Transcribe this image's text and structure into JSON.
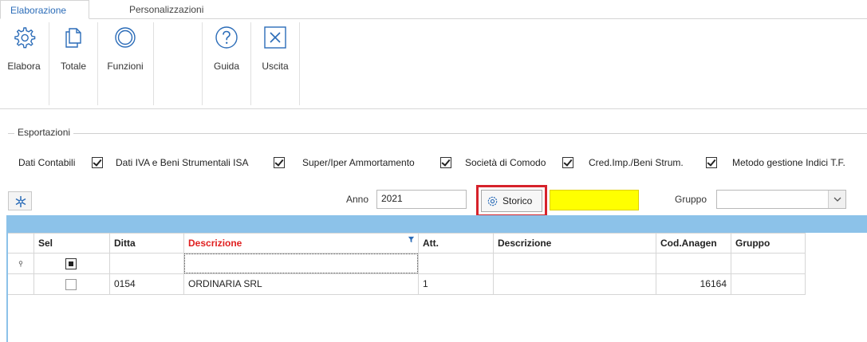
{
  "tabs": [
    {
      "label": "Elaborazione"
    },
    {
      "label": "Personalizzazioni"
    }
  ],
  "ribbon": {
    "buttons": [
      {
        "label": "Elabora",
        "icon": "gear-icon"
      },
      {
        "label": "Totale",
        "icon": "documents-icon"
      },
      {
        "label": "Funzioni",
        "icon": "ring-icon"
      },
      {
        "label": "Guida",
        "icon": "help-icon"
      },
      {
        "label": "Uscita",
        "icon": "close-box-icon"
      }
    ]
  },
  "esportazioni": {
    "title": "Esportazioni",
    "items": [
      {
        "label": "Dati Contabili",
        "checked": true
      },
      {
        "label": "Dati IVA e Beni Strumentali ISA",
        "checked": true
      },
      {
        "label": "Super/Iper Ammortamento",
        "checked": true
      },
      {
        "label": "Società di Comodo",
        "checked": true
      },
      {
        "label": "Cred.Imp./Beni Strum.",
        "checked": true
      },
      {
        "label": "Metodo gestione Indici T.F.",
        "checked": false
      }
    ]
  },
  "filters": {
    "anno_label": "Anno",
    "anno_value": "2021",
    "storico_label": "Storico",
    "gruppo_label": "Gruppo",
    "gruppo_value": ""
  },
  "grid": {
    "columns": [
      "Sel",
      "Ditta",
      "Descrizione",
      "Att.",
      "Descrizione",
      "Cod.Anagen",
      "Gruppo"
    ],
    "rows": [
      {
        "sel": false,
        "ditta": "0154",
        "descrizione": "ORDINARIA SRL",
        "att": "1",
        "descrizione2": "",
        "cod_anagen": "16164",
        "gruppo": ""
      }
    ]
  },
  "colors": {
    "accent": "#2b6cb8",
    "highlight_border": "#d6222b",
    "yellow_field": "#ffff00",
    "grid_band": "#8cc2e9",
    "header_red": "#e02020"
  }
}
